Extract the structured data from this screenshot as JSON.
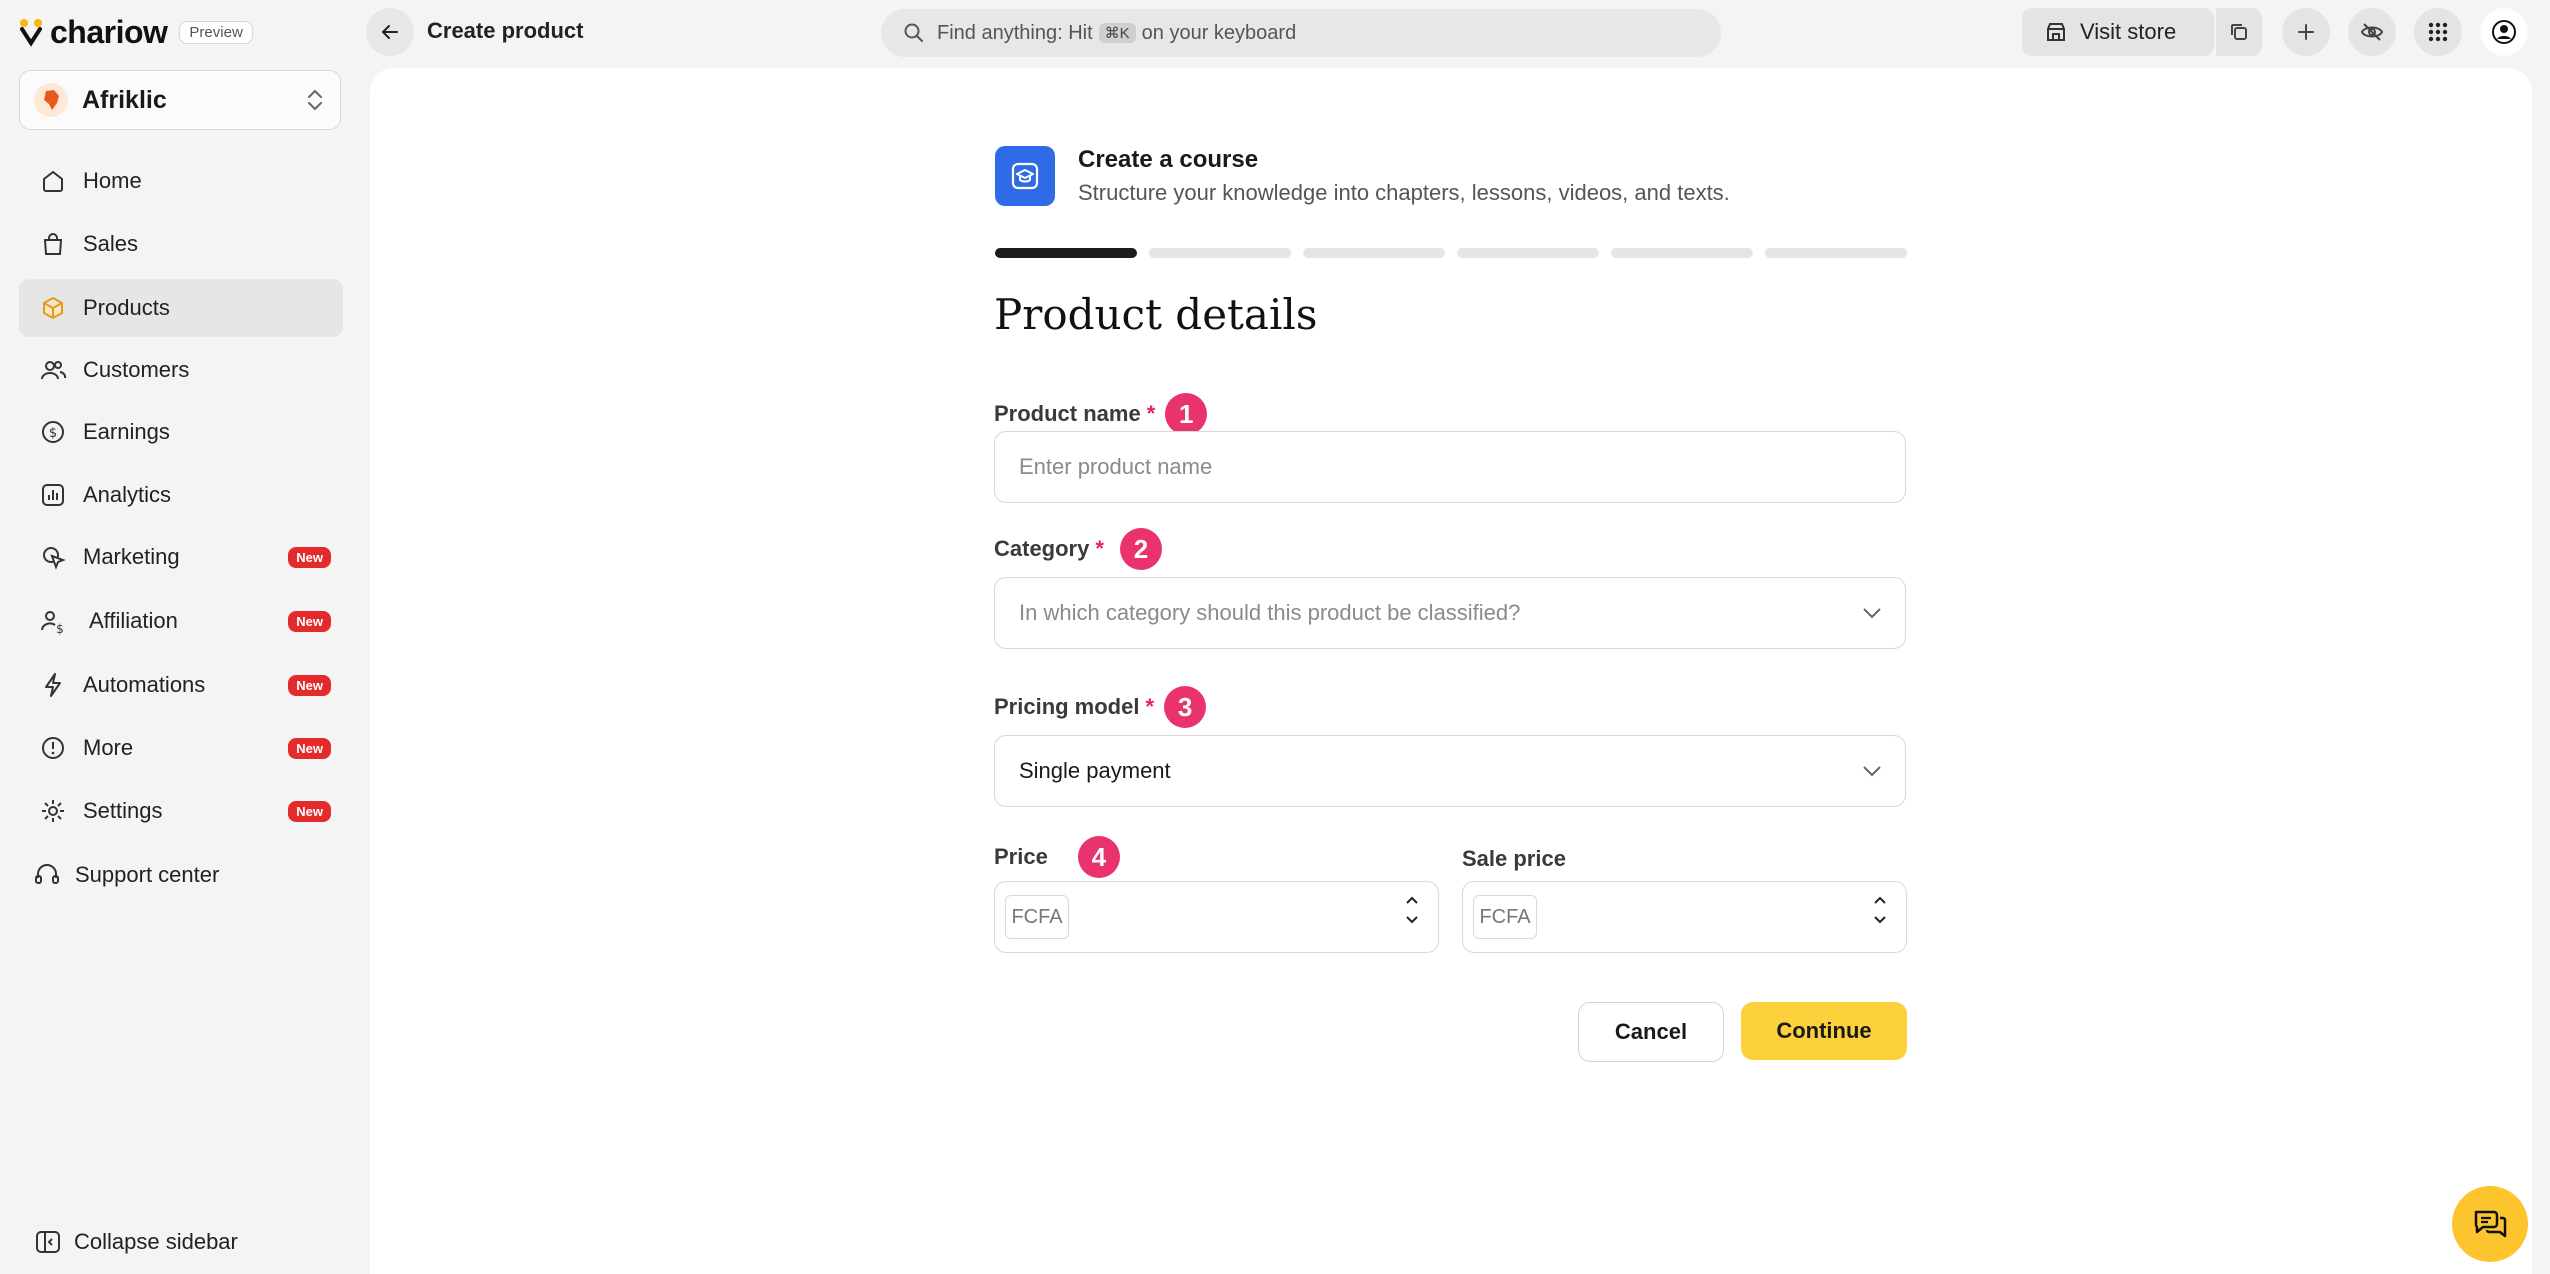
{
  "app": {
    "logo_text": "chariow",
    "preview_label": "Preview"
  },
  "store": {
    "name": "Afriklic"
  },
  "sidebar": {
    "items": [
      {
        "label": "Home",
        "icon": "home-icon",
        "badge": ""
      },
      {
        "label": "Sales",
        "icon": "shopping-bag-icon",
        "badge": ""
      },
      {
        "label": "Products",
        "icon": "box-icon",
        "badge": ""
      },
      {
        "label": "Customers",
        "icon": "users-icon",
        "badge": ""
      },
      {
        "label": "Earnings",
        "icon": "dollar-cycle-icon",
        "badge": ""
      },
      {
        "label": "Analytics",
        "icon": "bar-chart-icon",
        "badge": ""
      },
      {
        "label": "Marketing",
        "icon": "cursor-click-icon",
        "badge": "New"
      },
      {
        "label": "Affiliation",
        "icon": "user-dollar-icon",
        "badge": "New"
      },
      {
        "label": "Automations",
        "icon": "lightning-icon",
        "badge": "New"
      },
      {
        "label": "More",
        "icon": "info-circle-icon",
        "badge": "New"
      },
      {
        "label": "Settings",
        "icon": "gear-icon",
        "badge": "New"
      }
    ],
    "support_label": "Support center",
    "collapse_label": "Collapse sidebar"
  },
  "topbar": {
    "page_title": "Create product",
    "search_prefix": "Find anything: Hit",
    "search_kbd": "⌘K",
    "search_suffix": "on your keyboard",
    "visit_store_label": "Visit store"
  },
  "course": {
    "title": "Create a course",
    "subtitle": "Structure your knowledge into chapters, lessons, videos, and texts."
  },
  "progress": {
    "total_steps": 6,
    "current_step": 1
  },
  "form": {
    "section_title": "Product details",
    "product_name": {
      "label": "Product name",
      "required": "*",
      "marker": "1",
      "placeholder": "Enter product name",
      "value": ""
    },
    "category": {
      "label": "Category",
      "required": "*",
      "marker": "2",
      "placeholder": "In which category should this product be classified?"
    },
    "pricing_model": {
      "label": "Pricing model",
      "required": "*",
      "marker": "3",
      "value": "Single payment"
    },
    "price": {
      "label": "Price",
      "marker": "4",
      "currency": "FCFA",
      "value": ""
    },
    "sale_price": {
      "label": "Sale price",
      "currency": "FCFA",
      "value": ""
    },
    "cancel_label": "Cancel",
    "continue_label": "Continue"
  },
  "colors": {
    "accent_yellow": "#fdd13c",
    "marker_pink": "#e8336d",
    "badge_red": "#e32b2b",
    "course_blue": "#2f6be6"
  }
}
